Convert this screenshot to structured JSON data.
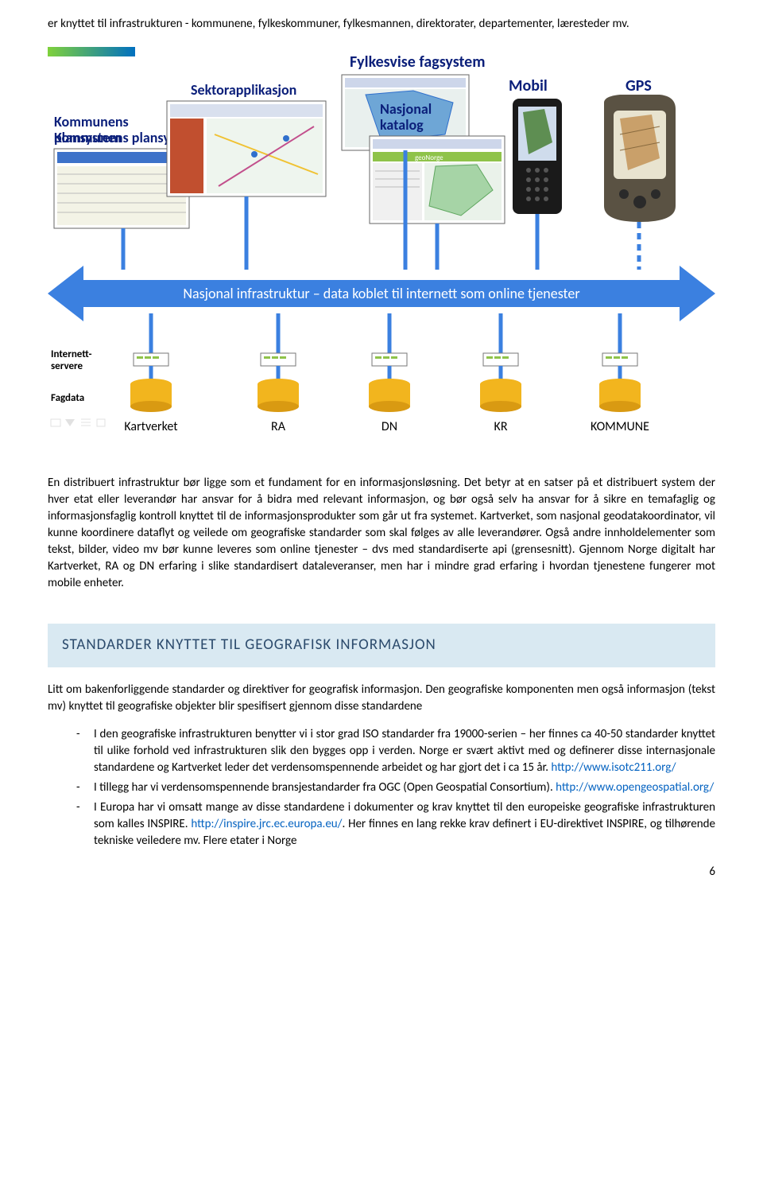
{
  "intro_para": "er knyttet til infrastrukturen - kommunene, fylkeskommuner, fylkesmannen, direktorater, departementer, læresteder mv.",
  "diagram": {
    "labels": {
      "kommunens_plansystem": "Kommunens plansystem",
      "sektorapplikasjon": "Sektorapplikasjon",
      "fylkesvise_fagsystem": "Fylkesvise fagsystem",
      "nasjonal_katalog": "Nasjonal katalog",
      "mobil": "Mobil",
      "gps": "GPS",
      "arrow_text": "Nasjonal infrastruktur – data koblet til internett som online tjenester",
      "internett_servere": "Internett-servere",
      "fagdata": "Fagdata",
      "sources": [
        "Kartverket",
        "RA",
        "DN",
        "KR",
        "KOMMUNE"
      ]
    }
  },
  "mid_para": "En distribuert infrastruktur bør ligge som et fundament for en informasjonsløsning. Det betyr at en satser på et distribuert system der hver etat eller leverandør har ansvar for å bidra med relevant informasjon, og bør også selv ha ansvar for å sikre en temafaglig og informasjonsfaglig kontroll knyttet til de informasjonsprodukter som går ut fra systemet. Kartverket, som nasjonal geodatakoordinator, vil kunne koordinere dataflyt og veilede om geografiske standarder som skal følges av alle leverandører. Også andre innholdelementer som tekst, bilder, video mv bør kunne leveres som online tjenester – dvs med standardiserte api (grensesnitt). Gjennom Norge digitalt har Kartverket, RA og DN erfaring i slike standardisert dataleveranser, men har i mindre grad erfaring i hvordan tjenestene fungerer mot mobile enheter.",
  "section_title": "STANDARDER KNYTTET TIL GEOGRAFISK INFORMASJON",
  "section_intro": "Litt om bakenforliggende standarder og direktiver for geografisk informasjon. Den geografiske komponenten men også informasjon (tekst mv) knyttet til geografiske objekter blir spesifisert gjennom disse standardene",
  "bullets": [
    {
      "pre": "I den geografiske infrastrukturen benytter vi i stor grad ISO standarder fra 19000-serien – her finnes ca 40-50 standarder knyttet til ulike forhold ved infrastrukturen slik den bygges opp i verden. Norge er svært aktivt med og definerer disse internasjonale standardene og Kartverket leder det verdensomspennende arbeidet og har gjort det i ca 15 år. ",
      "link": "http://www.isotc211.org/",
      "post": ""
    },
    {
      "pre": "I tillegg har vi verdensomspennende bransjestandarder fra OGC (Open Geospatial Consortium). ",
      "link": "http://www.opengeospatial.org/",
      "post": ""
    },
    {
      "pre": "I Europa har vi omsatt mange av disse standardene i dokumenter og krav knyttet til den europeiske geografiske infrastrukturen som kalles INSPIRE.  ",
      "link": "http://inspire.jrc.ec.europa.eu/",
      "post": ". Her finnes en lang rekke krav definert i EU-direktivet INSPIRE, og tilhørende tekniske veiledere mv. Flere etater i Norge"
    }
  ],
  "page_number": "6"
}
